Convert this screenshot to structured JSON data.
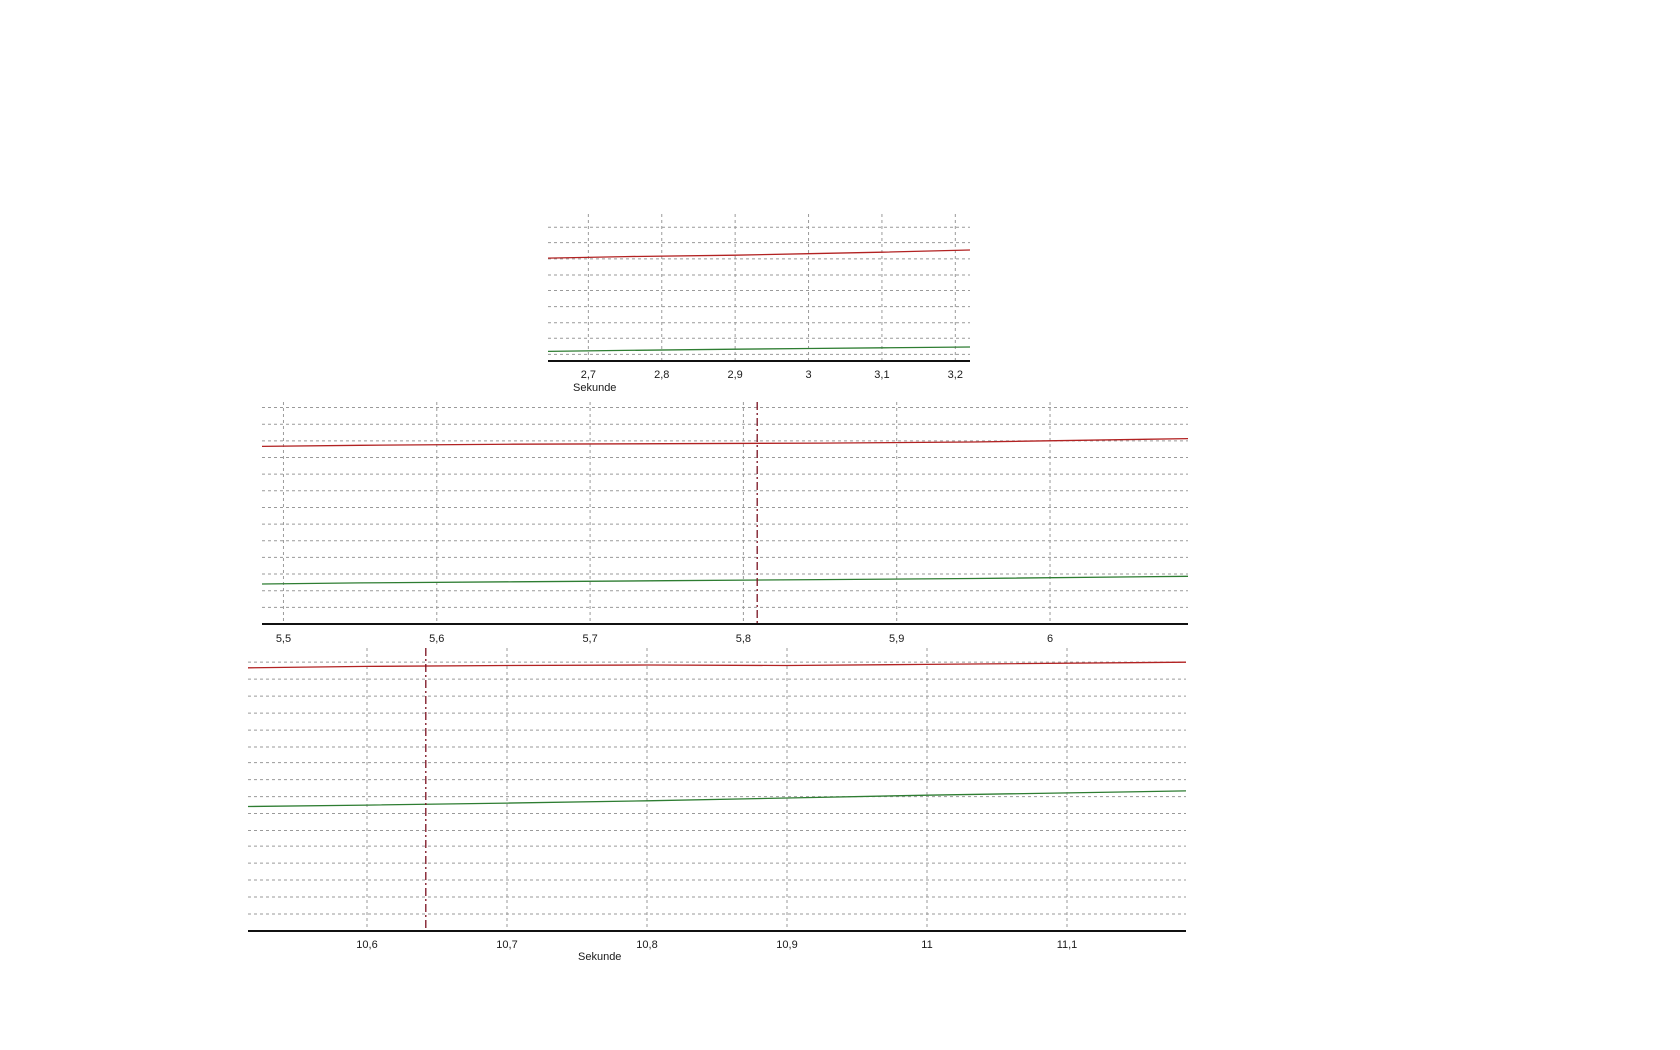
{
  "chart_data": [
    {
      "type": "line",
      "title": "",
      "xlabel": "Sekunde",
      "ylabel": "",
      "xlim": [
        2.645,
        3.22
      ],
      "ylim": [
        0,
        10
      ],
      "grid": true,
      "decimal_separator": ",",
      "x_ticks": [
        {
          "value": 2.7,
          "label": "2,7"
        },
        {
          "value": 2.8,
          "label": "2,8"
        },
        {
          "value": 2.9,
          "label": "2,9"
        },
        {
          "value": 3.0,
          "label": "3"
        },
        {
          "value": 3.1,
          "label": "3,1"
        },
        {
          "value": 3.2,
          "label": "3,2"
        }
      ],
      "y_gridlines": [
        0.45,
        1.55,
        2.6,
        3.7,
        4.8,
        5.85,
        6.95,
        8.05,
        9.1
      ],
      "series": [
        {
          "color": "#b22222",
          "x": [
            2.645,
            2.75,
            2.9,
            3.0,
            3.1,
            3.22
          ],
          "y": [
            7.0,
            7.1,
            7.2,
            7.3,
            7.4,
            7.55
          ]
        },
        {
          "color": "#2e7d32",
          "x": [
            2.645,
            2.75,
            2.9,
            3.0,
            3.1,
            3.22
          ],
          "y": [
            0.65,
            0.72,
            0.8,
            0.85,
            0.9,
            0.95
          ]
        }
      ],
      "cursor": null
    },
    {
      "type": "line",
      "title": "",
      "xlabel": "",
      "ylabel": "",
      "xlim": [
        5.486,
        6.09
      ],
      "ylim": [
        0,
        10
      ],
      "grid": true,
      "decimal_separator": ",",
      "x_ticks": [
        {
          "value": 5.5,
          "label": "5,5"
        },
        {
          "value": 5.6,
          "label": "5,6"
        },
        {
          "value": 5.7,
          "label": "5,7"
        },
        {
          "value": 5.8,
          "label": "5,8"
        },
        {
          "value": 5.9,
          "label": "5,9"
        },
        {
          "value": 6.0,
          "label": "6"
        }
      ],
      "y_gridlines": [
        0.75,
        1.5,
        2.25,
        3.0,
        3.75,
        4.5,
        5.25,
        6.0,
        6.75,
        7.5,
        8.25,
        9.0,
        9.75
      ],
      "series": [
        {
          "color": "#b22222",
          "x": [
            5.486,
            5.55,
            5.65,
            5.75,
            5.85,
            5.95,
            6.09
          ],
          "y": [
            8.0,
            8.05,
            8.1,
            8.12,
            8.15,
            8.2,
            8.35
          ]
        },
        {
          "color": "#2e7d32",
          "x": [
            5.486,
            5.55,
            5.65,
            5.75,
            5.85,
            5.95,
            6.09
          ],
          "y": [
            1.8,
            1.85,
            1.9,
            1.95,
            2.0,
            2.05,
            2.15
          ]
        }
      ],
      "cursor": {
        "x": 5.809,
        "color": "#7a1020"
      }
    },
    {
      "type": "line",
      "title": "",
      "xlabel": "Sekunde",
      "ylabel": "",
      "xlim": [
        10.515,
        11.185
      ],
      "ylim": [
        0,
        10
      ],
      "grid": true,
      "decimal_separator": ",",
      "x_ticks": [
        {
          "value": 10.6,
          "label": "10,6"
        },
        {
          "value": 10.7,
          "label": "10,7"
        },
        {
          "value": 10.8,
          "label": "10,8"
        },
        {
          "value": 10.9,
          "label": "10,9"
        },
        {
          "value": 11.0,
          "label": "11"
        },
        {
          "value": 11.1,
          "label": "11,1"
        }
      ],
      "y_gridlines": [
        0.6,
        1.2,
        1.8,
        2.4,
        3.0,
        3.55,
        4.15,
        4.75,
        5.35,
        5.95,
        6.5,
        7.1,
        7.7,
        8.3,
        8.9,
        9.5
      ],
      "series": [
        {
          "color": "#b22222",
          "x": [
            10.515,
            10.6,
            10.7,
            10.8,
            10.9,
            11.0,
            11.185
          ],
          "y": [
            9.3,
            9.35,
            9.38,
            9.4,
            9.38,
            9.42,
            9.5
          ]
        },
        {
          "color": "#2e7d32",
          "x": [
            10.515,
            10.6,
            10.7,
            10.8,
            10.9,
            11.0,
            11.185
          ],
          "y": [
            4.4,
            4.45,
            4.52,
            4.6,
            4.7,
            4.8,
            4.95
          ]
        }
      ],
      "cursor": {
        "x": 10.642,
        "color": "#7a1020"
      }
    }
  ]
}
